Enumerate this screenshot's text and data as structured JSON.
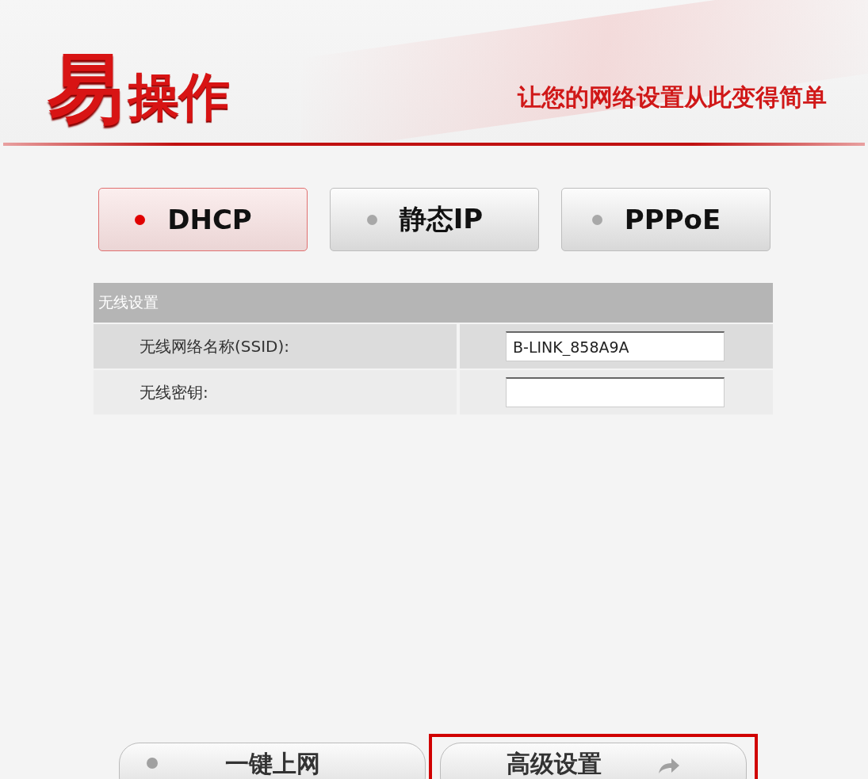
{
  "header": {
    "logo_big": "易",
    "logo_rest": "操作",
    "slogan": "让您的网络设置从此变得简单"
  },
  "modes": [
    {
      "label": "DHCP",
      "selected": true
    },
    {
      "label": "静态IP",
      "selected": false
    },
    {
      "label": "PPPoE",
      "selected": false
    }
  ],
  "wireless": {
    "title": "无线设置",
    "rows": [
      {
        "label": "无线网络名称(SSID):",
        "value": "B-LINK_858A9A"
      },
      {
        "label": "无线密钥:",
        "value": ""
      }
    ]
  },
  "actions": [
    {
      "label": "一键上网",
      "kind": "dot",
      "highlighted": false
    },
    {
      "label": "高级设置",
      "kind": "arrow",
      "highlighted": true
    }
  ]
}
